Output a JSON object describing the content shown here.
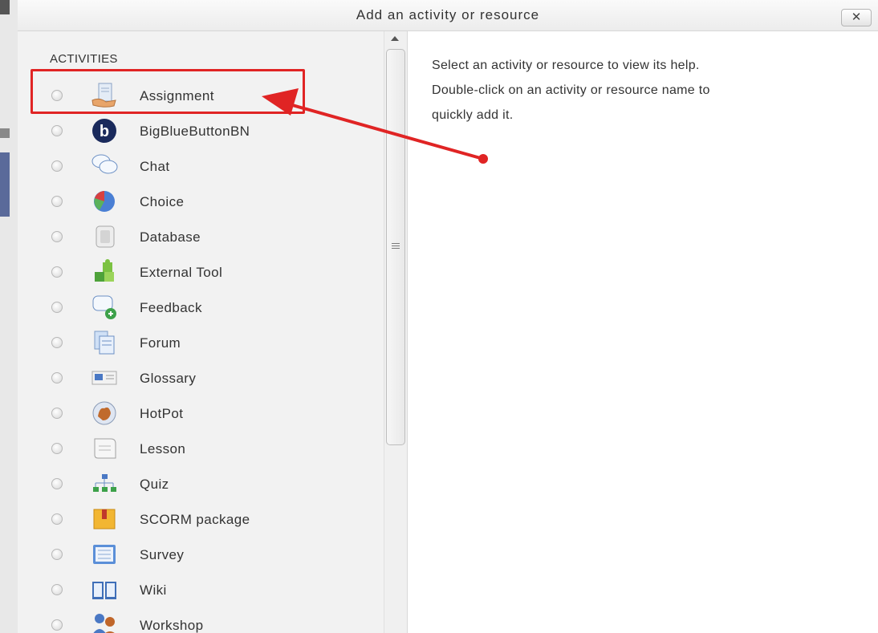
{
  "dialog": {
    "title": "Add an activity or resource",
    "close_label": "✕"
  },
  "activities": {
    "section_title": "ACTIVITIES",
    "items": [
      {
        "label": "Assignment",
        "icon": "assignment-icon"
      },
      {
        "label": "BigBlueButtonBN",
        "icon": "bigbluebutton-icon"
      },
      {
        "label": "Chat",
        "icon": "chat-icon"
      },
      {
        "label": "Choice",
        "icon": "choice-icon"
      },
      {
        "label": "Database",
        "icon": "database-icon"
      },
      {
        "label": "External Tool",
        "icon": "external-tool-icon"
      },
      {
        "label": "Feedback",
        "icon": "feedback-icon"
      },
      {
        "label": "Forum",
        "icon": "forum-icon"
      },
      {
        "label": "Glossary",
        "icon": "glossary-icon"
      },
      {
        "label": "HotPot",
        "icon": "hotpot-icon"
      },
      {
        "label": "Lesson",
        "icon": "lesson-icon"
      },
      {
        "label": "Quiz",
        "icon": "quiz-icon"
      },
      {
        "label": "SCORM package",
        "icon": "scorm-icon"
      },
      {
        "label": "Survey",
        "icon": "survey-icon"
      },
      {
        "label": "Wiki",
        "icon": "wiki-icon"
      },
      {
        "label": "Workshop",
        "icon": "workshop-icon"
      }
    ]
  },
  "help": {
    "lines": [
      "Select an activity or resource to view its help.",
      "Double-click on an activity or resource name to",
      "quickly add it."
    ]
  },
  "annotation": {
    "color": "#e02424",
    "highlighted_item": "Assignment"
  }
}
